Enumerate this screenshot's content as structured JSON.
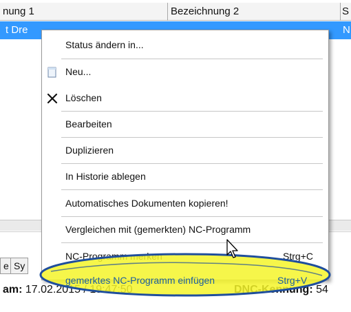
{
  "grid": {
    "columns": [
      "nung 1",
      "Bezeichnung 2",
      "S"
    ],
    "selected_row": {
      "cell1": "t Dre",
      "cell3": "N"
    }
  },
  "tabs": [
    "e",
    "Sy"
  ],
  "info": {
    "left_label": "am:",
    "left_value": "17.02.2015 / 19:47:50",
    "right_label": "DNC-Kennung:",
    "right_value": "54"
  },
  "context_menu": {
    "items": [
      {
        "label": "Status ändern in...",
        "shortcut": "",
        "icon": ""
      },
      {
        "label": "Neu...",
        "shortcut": "",
        "icon": "new-document-icon"
      },
      {
        "label": "Löschen",
        "shortcut": "",
        "icon": "delete-x-icon"
      },
      {
        "label": "Bearbeiten",
        "shortcut": "",
        "icon": ""
      },
      {
        "label": "Duplizieren",
        "shortcut": "",
        "icon": ""
      },
      {
        "label": "In Historie ablegen",
        "shortcut": "",
        "icon": ""
      },
      {
        "label": "Automatisches Dokumenten kopieren!",
        "shortcut": "",
        "icon": ""
      },
      {
        "label": "Vergleichen mit (gemerkten) NC-Programm",
        "shortcut": "",
        "icon": ""
      },
      {
        "label": "NC-Programm merken",
        "shortcut": "Strg+C",
        "icon": ""
      },
      {
        "label": "gemerktes NC-Programm einfügen",
        "shortcut": "Strg+V",
        "icon": ""
      }
    ]
  },
  "colors": {
    "selection": "#3399ff",
    "highlight_fill": "#f5f52a",
    "highlight_ring": "#1f4e9c",
    "highlight_text": "#1d5fa0"
  }
}
